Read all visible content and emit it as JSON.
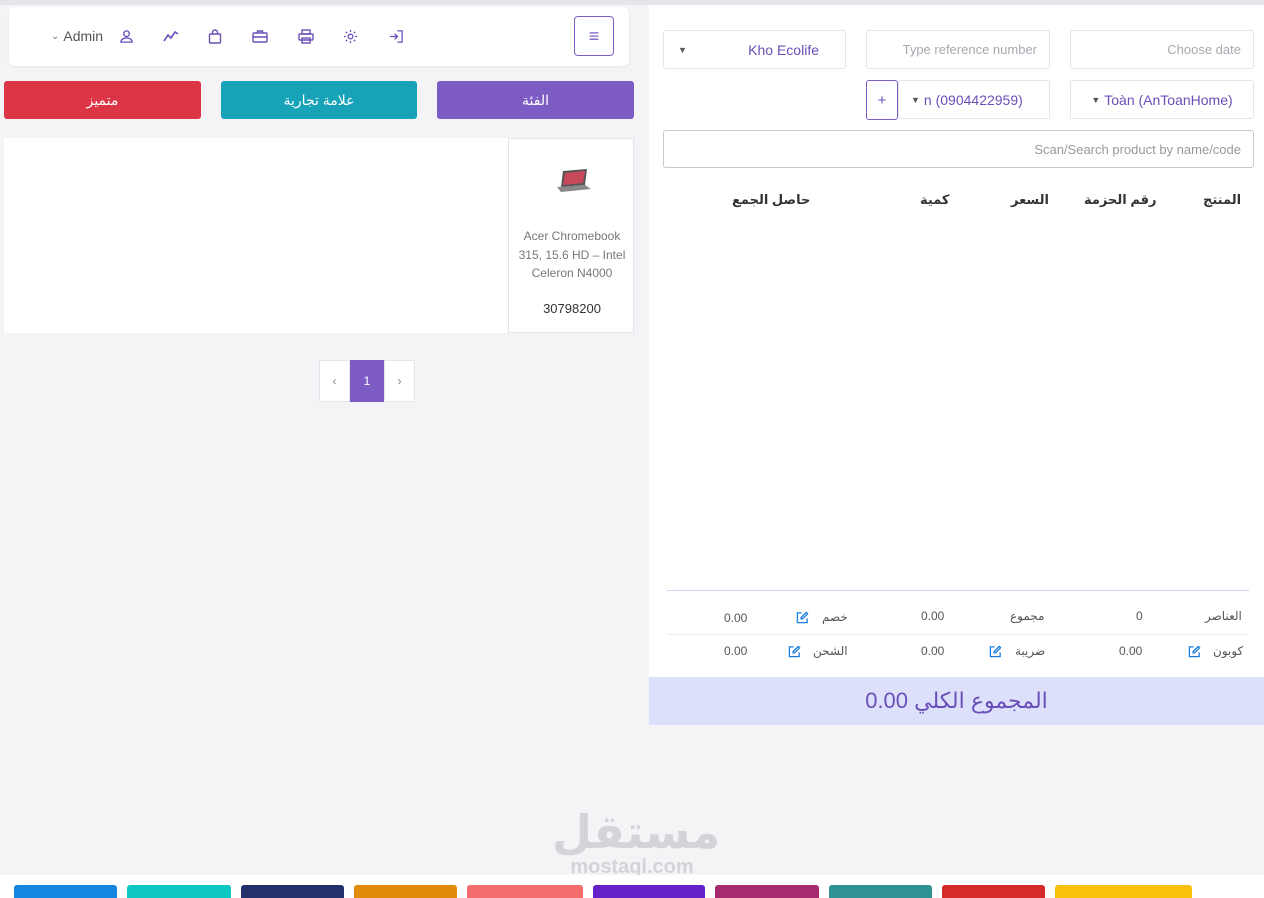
{
  "header": {
    "admin_label": "Admin",
    "icons": [
      "user-icon",
      "chart-icon",
      "bag-icon",
      "briefcase-icon",
      "printer-icon",
      "gear-icon",
      "login-icon"
    ]
  },
  "categories": {
    "featured_label": "متميز",
    "brand_label": "علامة تجارية",
    "category_label": "الفئة"
  },
  "colors": {
    "accent": "#7c5cc4",
    "featured": "#dc3545",
    "brand": "#17a2b8",
    "grand_total_bg": "#dde0fb",
    "edit_icon": "#1a7ee0"
  },
  "products": [
    {
      "name": "Acer Chromebook 315, 15.6 HD – Intel Celeron N4000",
      "price": "30798200"
    }
  ],
  "pagination": {
    "current": "1",
    "prev": "‹",
    "next": "›"
  },
  "form": {
    "warehouse": "Kho Ecolife",
    "reference_placeholder": "Type reference number",
    "date_placeholder": "Choose date",
    "customer": "n (0904422959)",
    "biller": "Toàn (AnToanHome)",
    "add_label": "+",
    "search_placeholder": "Scan/Search product by name/code"
  },
  "table": {
    "headers": {
      "product": "المنتج",
      "batch": "رقم الحزمة",
      "price": "السعر",
      "qty": "كمية",
      "subtotal": "حاصل الجمع"
    }
  },
  "totals": {
    "items_label": "العناصر",
    "items_value": "0",
    "subtotal_label": "مجموع",
    "subtotal_value": "0.00",
    "discount_label": "خصم",
    "discount_value": "0.00",
    "coupon_label": "كوبون",
    "coupon_value": "0.00",
    "tax_label": "ضريبة",
    "tax_value": "0.00",
    "shipping_label": "الشحن",
    "shipping_value": "0.00",
    "grand_total": "المجموع الكلي 0.00"
  },
  "watermark": {
    "arabic": "مستقل",
    "latin": "mostaql.com"
  },
  "bottom_buttons": [
    "#1485e0",
    "#0dc7c2",
    "#24306b",
    "#e28a0b",
    "#f56c6c",
    "#6422c8",
    "#a52a6e",
    "#2f9393",
    "#d42a2a",
    "#f9c10b"
  ]
}
